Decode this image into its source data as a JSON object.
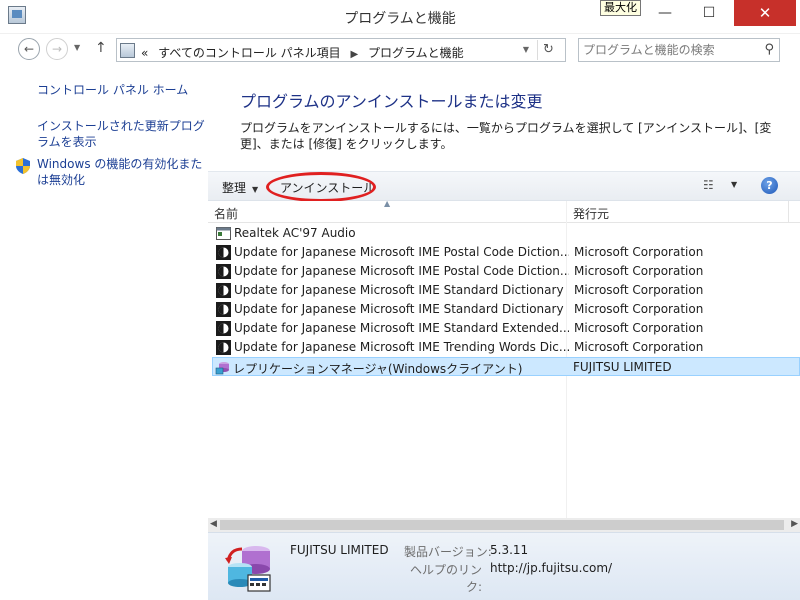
{
  "window": {
    "title": "プログラムと機能",
    "tooltip": "最大化",
    "controls": {
      "minimize": "—",
      "maximize": "☐",
      "close": "✕"
    }
  },
  "nav": {
    "back": "←",
    "forward": "→",
    "up": "↑",
    "breadcrumb_prefix": "«",
    "breadcrumb": [
      "すべてのコントロール パネル項目",
      "プログラムと機能"
    ],
    "refresh": "↻",
    "search_placeholder": "プログラムと機能の検索"
  },
  "sidebar": {
    "home": "コントロール パネル ホーム",
    "updates": "インストールされた更新プログラムを表示",
    "features": "Windows の機能の有効化または無効化"
  },
  "main": {
    "heading": "プログラムのアンインストールまたは変更",
    "description": "プログラムをアンインストールするには、一覧からプログラムを選択して [アンインストール]、[変更]、または [修復] をクリックします。"
  },
  "toolbar": {
    "organize": "整理",
    "uninstall": "アンインストール",
    "help": "?"
  },
  "columns": {
    "name": "名前",
    "publisher": "発行元"
  },
  "programs": [
    {
      "name": "Realtek AC'97 Audio",
      "publisher": "",
      "icon": "window-app-icon"
    },
    {
      "name": "Update for Japanese Microsoft IME Postal Code Diction...",
      "publisher": "Microsoft Corporation",
      "icon": "ime-update-icon"
    },
    {
      "name": "Update for Japanese Microsoft IME Postal Code Diction...",
      "publisher": "Microsoft Corporation",
      "icon": "ime-update-icon"
    },
    {
      "name": "Update for Japanese Microsoft IME Standard Dictionary",
      "publisher": "Microsoft Corporation",
      "icon": "ime-update-icon"
    },
    {
      "name": "Update for Japanese Microsoft IME Standard Dictionary",
      "publisher": "Microsoft Corporation",
      "icon": "ime-update-icon"
    },
    {
      "name": "Update for Japanese Microsoft IME Standard Extended...",
      "publisher": "Microsoft Corporation",
      "icon": "ime-update-icon"
    },
    {
      "name": "Update for Japanese Microsoft IME Trending Words Dic...",
      "publisher": "Microsoft Corporation",
      "icon": "ime-update-icon"
    },
    {
      "name": "レプリケーションマネージャ(Windowsクライアント)",
      "publisher": "FUJITSU LIMITED",
      "icon": "replication-icon",
      "selected": true
    }
  ],
  "details": {
    "company": "FUJITSU LIMITED",
    "version_label": "製品バージョン:",
    "version": "5.3.11",
    "help_label": "ヘルプのリンク:",
    "help_link": "http://jp.fujitsu.com/"
  },
  "colors": {
    "link": "#1c3f94",
    "heading": "#1e3287",
    "selection": "#cce8ff",
    "highlight_oval": "#e02020"
  }
}
